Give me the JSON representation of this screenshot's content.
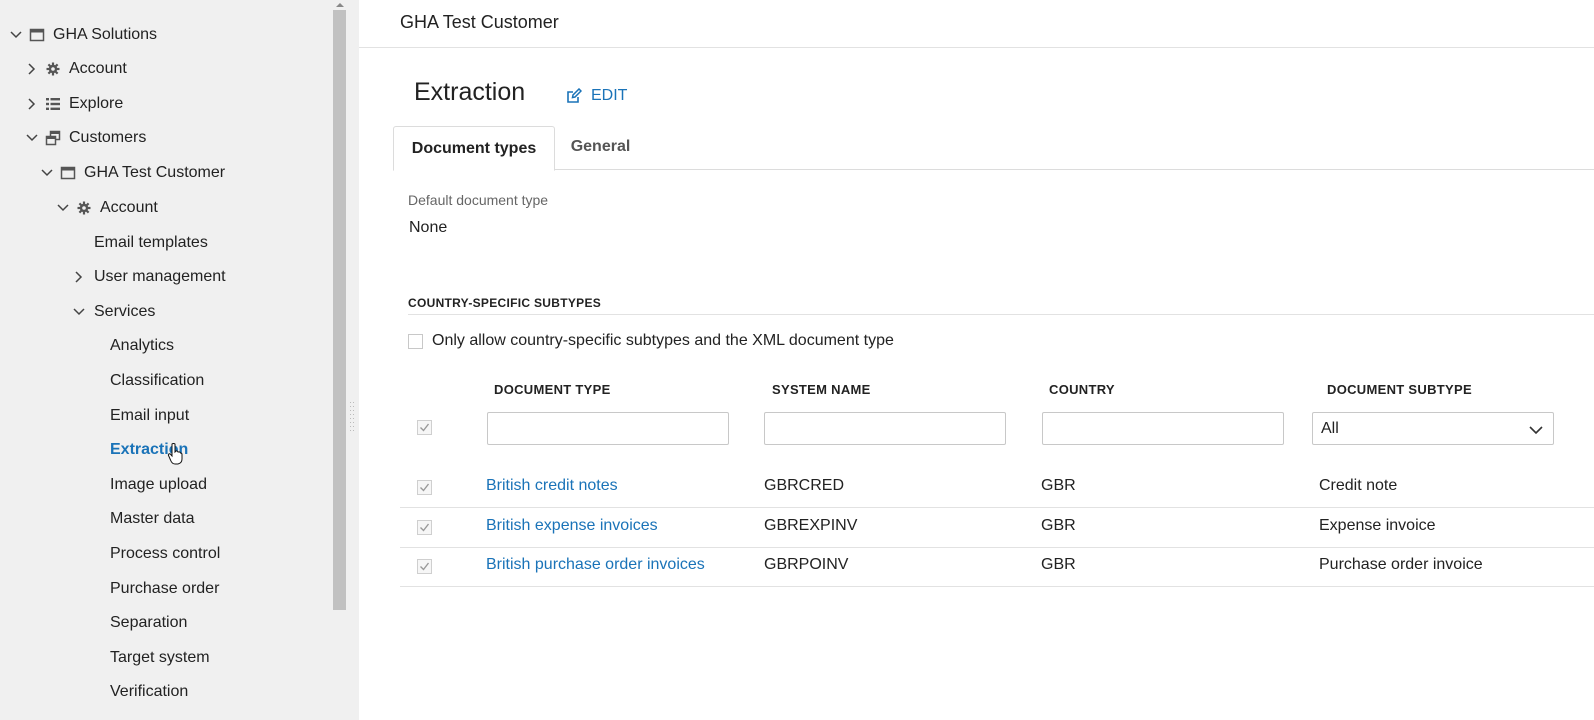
{
  "sidebar": {
    "items": [
      {
        "label": "GHA Solutions",
        "icon": "window-icon",
        "expanded": true
      },
      {
        "label": "Account",
        "icon": "gear-icon",
        "expanded": false
      },
      {
        "label": "Explore",
        "icon": "list-icon",
        "expanded": false
      },
      {
        "label": "Customers",
        "icon": "windows-icon",
        "expanded": true
      },
      {
        "label": "GHA Test Customer",
        "icon": "window-icon",
        "expanded": true
      },
      {
        "label": "Account",
        "icon": "gear-icon",
        "expanded": true
      },
      {
        "label": "Email templates"
      },
      {
        "label": "User management",
        "expanded": false
      },
      {
        "label": "Services",
        "expanded": true
      },
      {
        "label": "Analytics"
      },
      {
        "label": "Classification"
      },
      {
        "label": "Email input"
      },
      {
        "label": "Extraction",
        "active": true
      },
      {
        "label": "Image upload"
      },
      {
        "label": "Master data"
      },
      {
        "label": "Process control"
      },
      {
        "label": "Purchase order"
      },
      {
        "label": "Separation"
      },
      {
        "label": "Target system"
      },
      {
        "label": "Verification"
      }
    ]
  },
  "header": {
    "title": "GHA Test Customer"
  },
  "page": {
    "title": "Extraction",
    "edit_label": "EDIT"
  },
  "tabs": [
    {
      "label": "Document types",
      "active": true
    },
    {
      "label": "General",
      "active": false
    }
  ],
  "default_document_type": {
    "label": "Default document type",
    "value": "None"
  },
  "section": {
    "heading": "COUNTRY-SPECIFIC SUBTYPES"
  },
  "only_allow": {
    "label": "Only allow country-specific subtypes and the XML document type",
    "checked": false
  },
  "table": {
    "columns": [
      "DOCUMENT TYPE",
      "SYSTEM NAME",
      "COUNTRY",
      "DOCUMENT SUBTYPE"
    ],
    "filters": {
      "document_type": "",
      "system_name": "",
      "country": "",
      "document_subtype": "All"
    },
    "rows": [
      {
        "checked": true,
        "document_type": "British credit notes",
        "system_name": "GBRCRED",
        "country": "GBR",
        "document_subtype": "Credit note"
      },
      {
        "checked": true,
        "document_type": "British expense invoices",
        "system_name": "GBREXPINV",
        "country": "GBR",
        "document_subtype": "Expense invoice"
      },
      {
        "checked": true,
        "document_type": "British purchase order invoices",
        "system_name": "GBRPOINV",
        "country": "GBR",
        "document_subtype": "Purchase order invoice"
      }
    ]
  },
  "colors": {
    "accent": "#1a73b8",
    "sidebar_bg": "#f0f0f0"
  }
}
